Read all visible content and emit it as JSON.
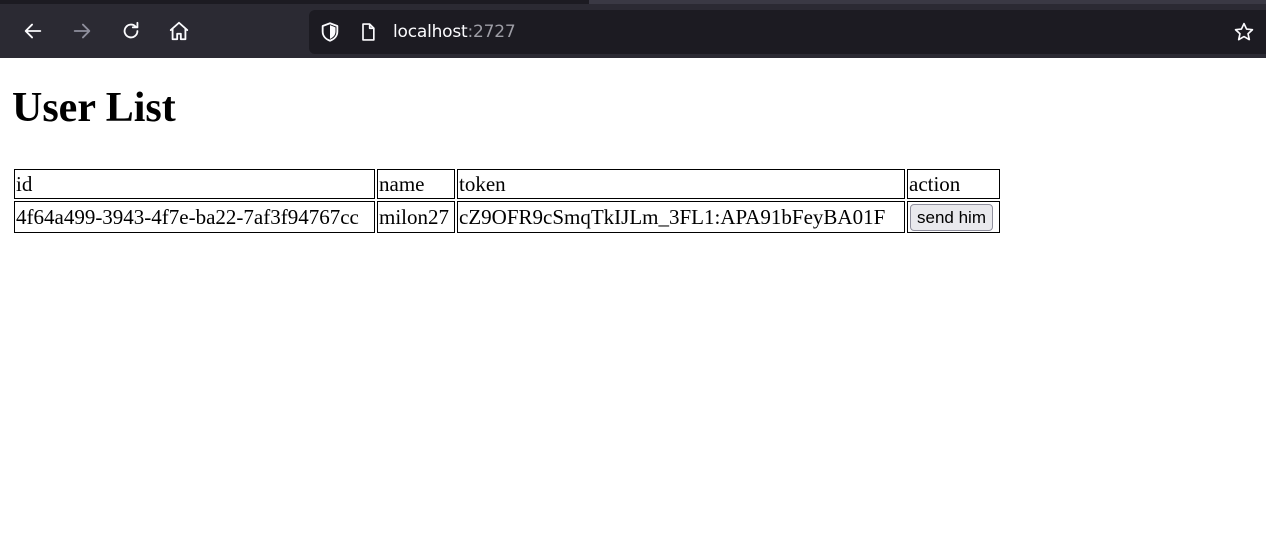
{
  "browser": {
    "url_host": "localhost",
    "url_port": ":2727",
    "icons": {
      "back": "arrow-left-icon",
      "forward": "arrow-right-icon",
      "reload": "reload-icon",
      "home": "home-icon",
      "shield": "shield-icon",
      "page": "page-icon",
      "bookmark": "star-icon"
    }
  },
  "page": {
    "title": "User List",
    "table": {
      "headers": [
        "id",
        "name",
        "token",
        "action"
      ],
      "rows": [
        {
          "id": "4f64a499-3943-4f7e-ba22-7af3f94767cc",
          "name": "milon27",
          "token": "cZ9OFR9cSmqTkIJLm_3FL1:APA91bFeyBA01F",
          "action_label": "send him"
        }
      ]
    }
  }
}
